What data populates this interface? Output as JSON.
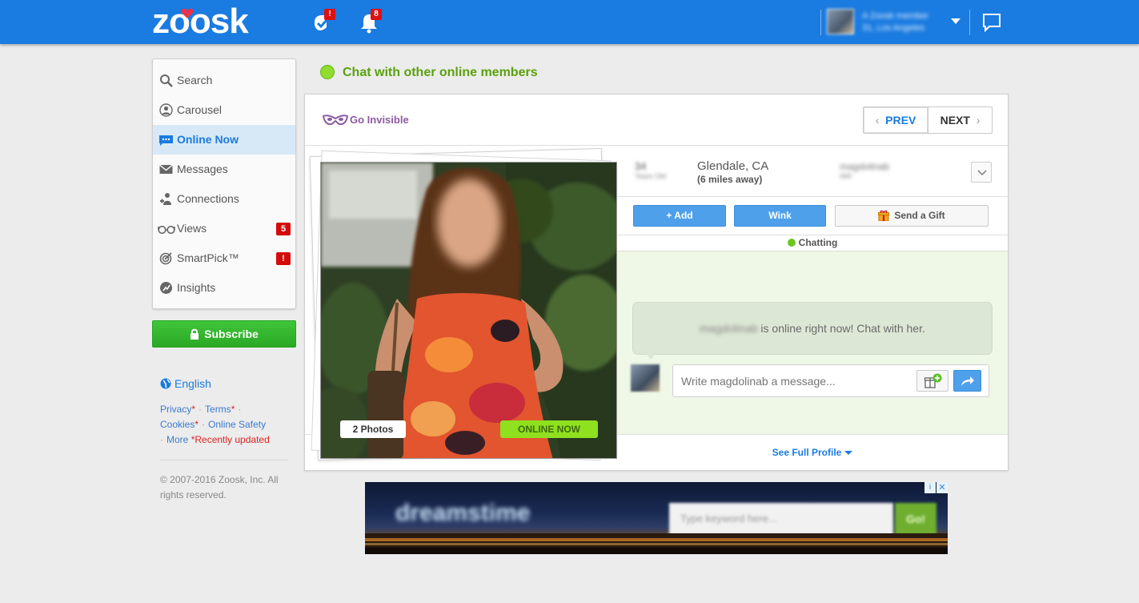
{
  "brand": {
    "logo_text": "zoosk",
    "primary_color": "#1a7be0"
  },
  "topbar": {
    "checkmark_badge": "!",
    "notifications_badge": "8",
    "user_name": "A Zoosk member",
    "user_location": "31, Los Angeles"
  },
  "sidebar": {
    "items": [
      {
        "label": "Search",
        "icon": "search-icon"
      },
      {
        "label": "Carousel",
        "icon": "carousel-icon"
      },
      {
        "label": "Online Now",
        "icon": "chat-bubble-icon",
        "active": true
      },
      {
        "label": "Messages",
        "icon": "envelope-icon"
      },
      {
        "label": "Connections",
        "icon": "connections-icon"
      },
      {
        "label": "Views",
        "icon": "glasses-icon",
        "badge": "5"
      },
      {
        "label": "SmartPick™",
        "icon": "target-icon",
        "badge": "!"
      },
      {
        "label": "Insights",
        "icon": "insights-icon"
      }
    ],
    "subscribe_label": "Subscribe",
    "language": "English",
    "footer": {
      "privacy": "Privacy",
      "terms": "Terms",
      "cookies": "Cookies",
      "online_safety": "Online Safety",
      "more": "More",
      "recently_updated": "Recently updated",
      "star": "*",
      "copyright": "© 2007-2016 Zoosk, Inc. All rights reserved."
    }
  },
  "main": {
    "header": "Chat with other online members",
    "go_invisible": "Go Invisible",
    "prev_label": "PREV",
    "next_label": "NEXT",
    "profile": {
      "age": "34",
      "age_label": "Years Old",
      "city": "Glendale, CA",
      "distance": "(6 miles away)",
      "username": "magdolinab",
      "username_sub": "###",
      "photos_label": "2 Photos",
      "online_label": "ONLINE NOW"
    },
    "actions": {
      "add": "+ Add",
      "wink": "Wink",
      "gift": "Send a Gift"
    },
    "status": "Chatting",
    "chat": {
      "bubble_name": "magdolinab",
      "bubble_text": " is online right now! Chat with her.",
      "input_placeholder": "Write magdolinab a message..."
    },
    "see_full_profile": "See Full Profile"
  },
  "ad": {
    "logo": "dreamstime",
    "search_placeholder": "Type keyword here...",
    "go": "Go!",
    "info": "i",
    "close": "✕"
  }
}
